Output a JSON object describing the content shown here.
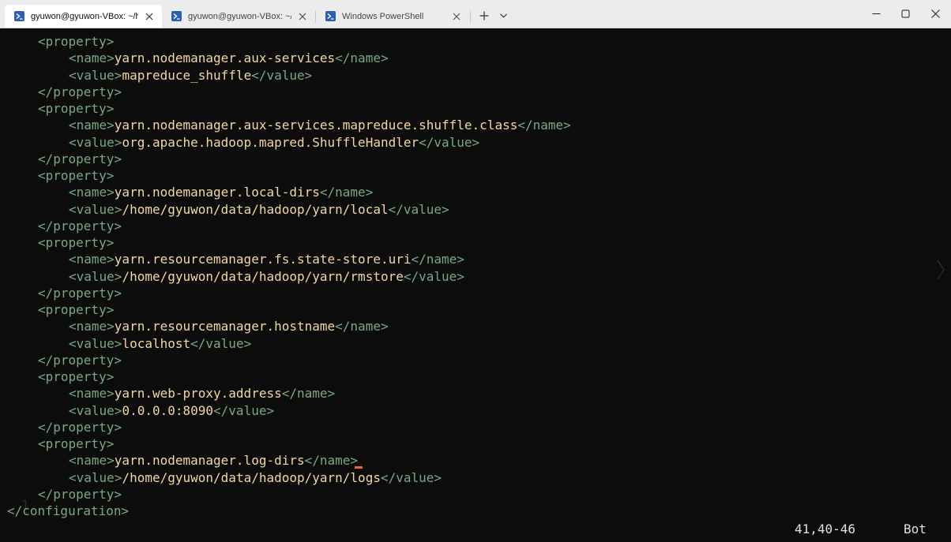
{
  "tabs": [
    {
      "title": "gyuwon@gyuwon-VBox: ~/h",
      "active": true
    },
    {
      "title": "gyuwon@gyuwon-VBox: ~/da",
      "active": false
    },
    {
      "title": "Windows PowerShell",
      "active": false
    }
  ],
  "icons": {
    "tab_icon": "terminal-icon",
    "close": "close-icon",
    "new_tab": "plus-icon",
    "dropdown": "chevron-down-icon",
    "minimize": "minimize-icon",
    "maximize": "maximize-icon",
    "window_close": "close-icon"
  },
  "colors": {
    "background": "#0c0c0c",
    "xml_tag": "#79a883",
    "xml_value": "#f2d8a0",
    "cursor": "#e8663a"
  },
  "terminal": {
    "lines": [
      {
        "kind": "open",
        "indent": 1,
        "tag": "<property>"
      },
      {
        "kind": "kv",
        "indent": 2,
        "open": "<name>",
        "value": "yarn.nodemanager.aux-services",
        "close": "</name>"
      },
      {
        "kind": "kv",
        "indent": 2,
        "open": "<value>",
        "value": "mapreduce_shuffle",
        "close": "</value>"
      },
      {
        "kind": "open",
        "indent": 1,
        "tag": "</property>"
      },
      {
        "kind": "open",
        "indent": 1,
        "tag": "<property>"
      },
      {
        "kind": "kv",
        "indent": 2,
        "open": "<name>",
        "value": "yarn.nodemanager.aux-services.mapreduce.shuffle.class",
        "close": "</name>"
      },
      {
        "kind": "kv",
        "indent": 2,
        "open": "<value>",
        "value": "org.apache.hadoop.mapred.ShuffleHandler",
        "close": "</value>"
      },
      {
        "kind": "open",
        "indent": 1,
        "tag": "</property>"
      },
      {
        "kind": "open",
        "indent": 1,
        "tag": "<property>"
      },
      {
        "kind": "kv",
        "indent": 2,
        "open": "<name>",
        "value": "yarn.nodemanager.local-dirs",
        "close": "</name>"
      },
      {
        "kind": "kv",
        "indent": 2,
        "open": "<value>",
        "value": "/home/gyuwon/data/hadoop/yarn/local",
        "close": "</value>"
      },
      {
        "kind": "open",
        "indent": 1,
        "tag": "</property>"
      },
      {
        "kind": "open",
        "indent": 1,
        "tag": "<property>"
      },
      {
        "kind": "kv",
        "indent": 2,
        "open": "<name>",
        "value": "yarn.resourcemanager.fs.state-store.uri",
        "close": "</name>"
      },
      {
        "kind": "kv",
        "indent": 2,
        "open": "<value>",
        "value": "/home/gyuwon/data/hadoop/yarn/rmstore",
        "close": "</value>"
      },
      {
        "kind": "open",
        "indent": 1,
        "tag": "</property>"
      },
      {
        "kind": "open",
        "indent": 1,
        "tag": "<property>"
      },
      {
        "kind": "kv",
        "indent": 2,
        "open": "<name>",
        "value": "yarn.resourcemanager.hostname",
        "close": "</name>"
      },
      {
        "kind": "kv",
        "indent": 2,
        "open": "<value>",
        "value": "localhost",
        "close": "</value>"
      },
      {
        "kind": "open",
        "indent": 1,
        "tag": "</property>"
      },
      {
        "kind": "open",
        "indent": 1,
        "tag": "<property>"
      },
      {
        "kind": "kv",
        "indent": 2,
        "open": "<name>",
        "value": "yarn.web-proxy.address",
        "close": "</name>"
      },
      {
        "kind": "kv",
        "indent": 2,
        "open": "<value>",
        "value": "0.0.0.0:8090",
        "close": "</value>"
      },
      {
        "kind": "open",
        "indent": 1,
        "tag": "</property>"
      },
      {
        "kind": "open",
        "indent": 1,
        "tag": "<property>"
      },
      {
        "kind": "kv",
        "indent": 2,
        "open": "<name>",
        "value": "yarn.nodemanager.log-dirs",
        "close": "</name>"
      },
      {
        "kind": "kv",
        "indent": 2,
        "open": "<value>",
        "value": "/home/gyuwon/data/hadoop/yarn/logs",
        "close": "</value>"
      },
      {
        "kind": "open",
        "indent": 1,
        "tag": "</property>"
      },
      {
        "kind": "open",
        "indent": 0,
        "tag": "</configuration>"
      }
    ],
    "gutter_number": "1",
    "status": {
      "position": "41,40-46",
      "scroll": "Bot"
    }
  }
}
